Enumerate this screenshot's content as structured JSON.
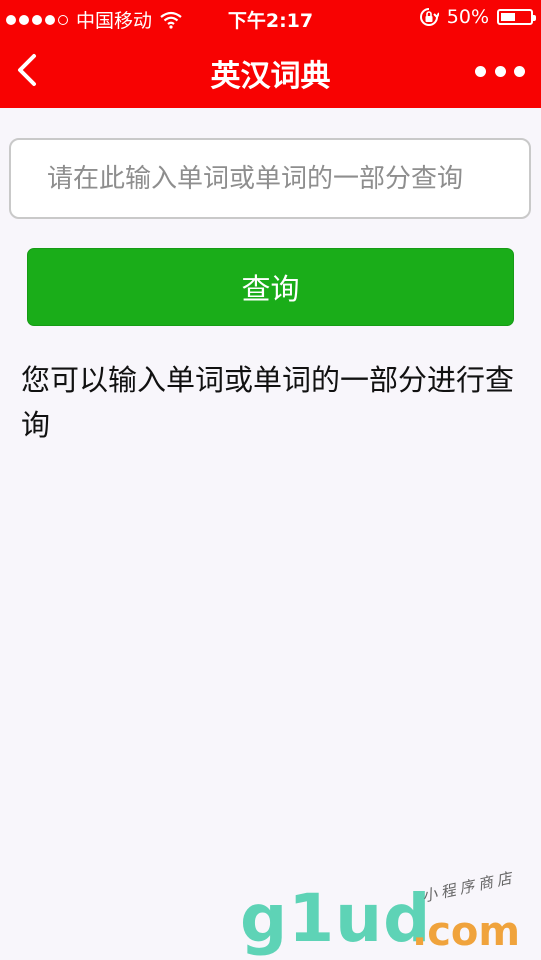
{
  "status_bar": {
    "carrier": "中国移动",
    "time": "下午2:17",
    "battery_text": "50%",
    "battery_level": 0.5,
    "signal_icon": "signal-dots-icon",
    "wifi_icon": "wifi-icon",
    "rotation_lock_icon": "rotation-lock-icon"
  },
  "nav": {
    "title": "英汉词典",
    "back_icon": "chevron-left-icon",
    "more_icon": "more-dots-icon"
  },
  "search": {
    "placeholder": "请在此输入单词或单词的一部分查询",
    "value": ""
  },
  "query_button": {
    "label": "查询"
  },
  "hint_text": " 您可以输入单词或单词的一部分进行查询",
  "watermark": {
    "logo": "g1ud",
    "domain": ".com",
    "tagline": "小程序商店"
  },
  "colors": {
    "header_red": "#f80202",
    "button_green": "#1aad19",
    "background": "#f8f6fb"
  }
}
